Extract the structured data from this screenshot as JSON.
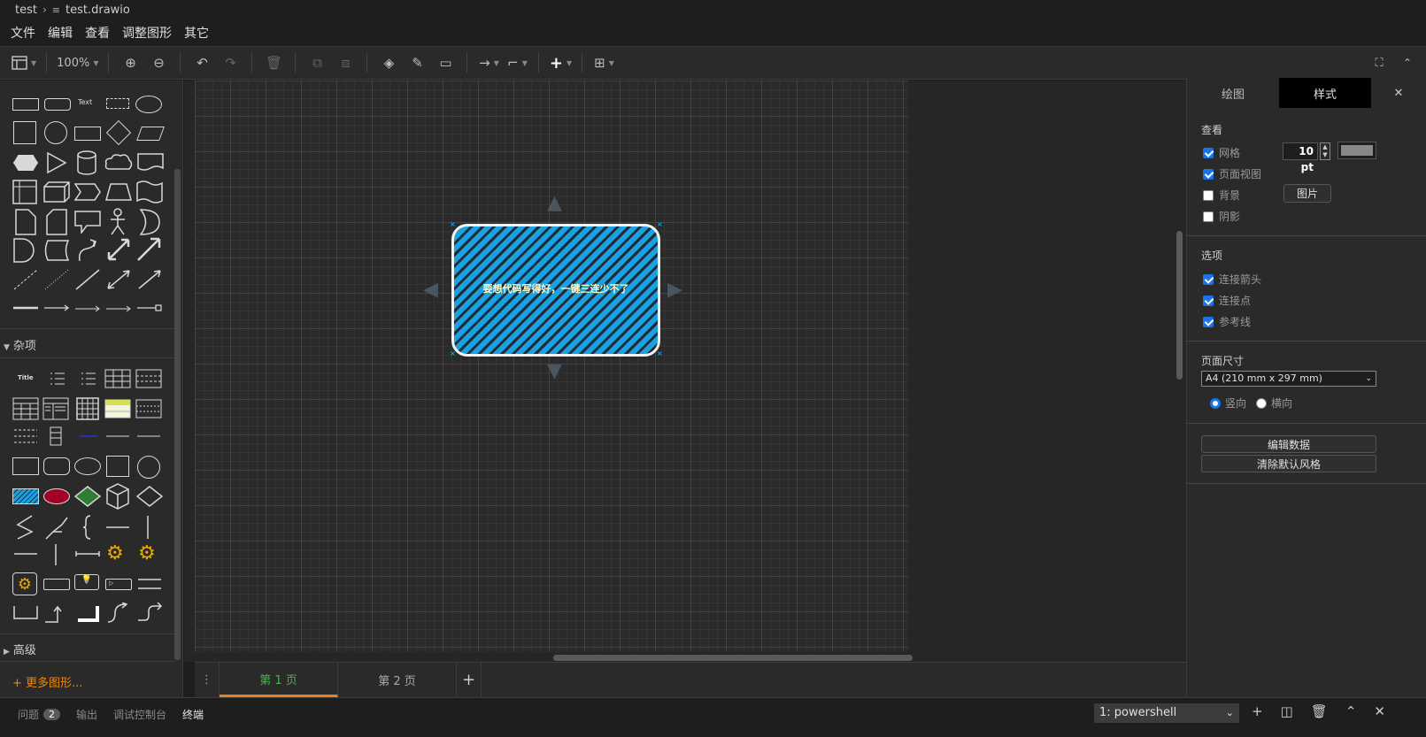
{
  "breadcrumb": {
    "folder": "test",
    "file": "test.drawio"
  },
  "menu": [
    "文件",
    "编辑",
    "查看",
    "调整图形",
    "其它"
  ],
  "toolbar": {
    "zoom": "100%"
  },
  "sidebar": {
    "text_shape_label": "Text",
    "misc_title_label": "Title",
    "section_misc": "杂项",
    "section_advanced": "高级",
    "more_shapes": "+ 更多图形..."
  },
  "canvas": {
    "shape_text": "要想代码写得好，一键三连少不了"
  },
  "pages": [
    "第 1 页",
    "第 2 页"
  ],
  "panel": {
    "tab_diagram": "绘图",
    "tab_style": "样式",
    "view_title": "查看",
    "grid": "网格",
    "grid_size": "10 pt",
    "page_view": "页面视图",
    "background": "背景",
    "image_button": "图片",
    "shadow": "阴影",
    "options_title": "选项",
    "connection_arrows": "连接箭头",
    "connection_points": "连接点",
    "guides": "参考线",
    "paper_title": "页面尺寸",
    "paper_size": "A4 (210 mm x 297 mm)",
    "portrait": "竖向",
    "landscape": "横向",
    "edit_data": "编辑数据",
    "clear_style": "清除默认风格"
  },
  "statusbar": {
    "problems": "问题",
    "problems_count": "2",
    "output": "输出",
    "debug_console": "调试控制台",
    "terminal": "终端",
    "terminal_select": "1: powershell"
  },
  "colors": {
    "accent": "#1ba1e2",
    "more_shapes": "#f08705",
    "active_page": "#4caf50"
  }
}
